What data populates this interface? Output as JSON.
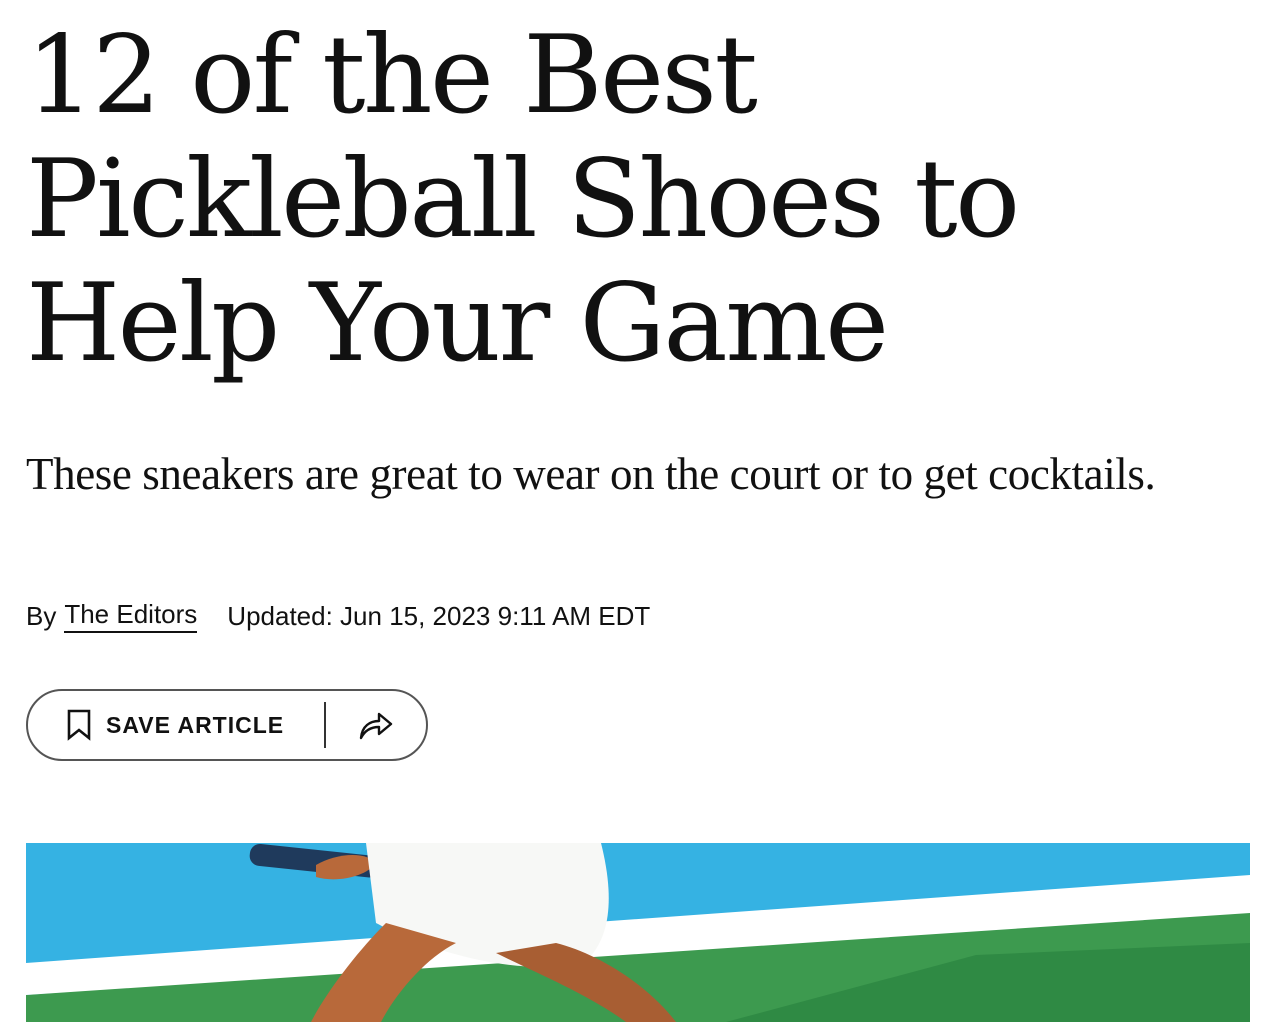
{
  "article": {
    "headline_lines": [
      "12 of the Best",
      "Pickleball Shoes to",
      "Help Your Game"
    ],
    "dek": "These sneakers are great to wear on the court or to get cocktails.",
    "byline_prefix": "By",
    "author": "The Editors",
    "updated": "Updated: Jun 15, 2023 9:11 AM EDT"
  },
  "actions": {
    "save_label": "SAVE ARTICLE",
    "save_icon": "bookmark-icon",
    "share_icon": "share-icon"
  },
  "hero_image": {
    "subject": "pickleball player on court",
    "colors": {
      "sky": "#35b2e3",
      "court_green": "#3d9a4f",
      "line_white": "#ffffff",
      "skin": "#b8693a",
      "skirt": "#f7f8f6",
      "paddle": "#1f3a5c"
    }
  }
}
